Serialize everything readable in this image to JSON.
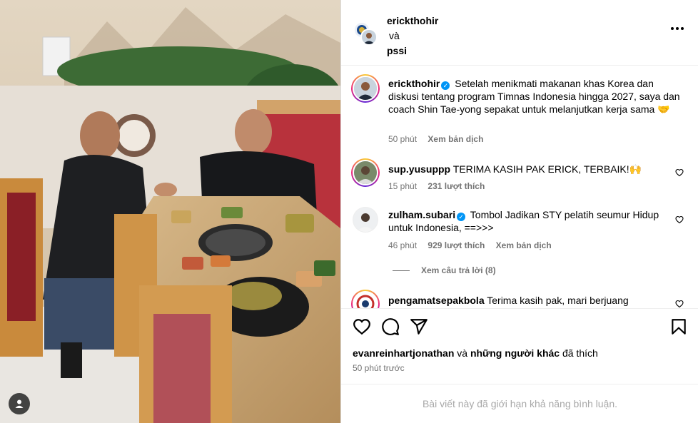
{
  "header": {
    "user1": "erickthohir",
    "and": "và",
    "user2": "pssi"
  },
  "caption": {
    "user": "erickthohir",
    "text": "Setelah menikmati makanan khas Korea dan diskusi tentang program Timnas Indonesia hingga 2027, saya dan coach Shin Tae-yong sepakat untuk melanjutkan kerja sama",
    "emoji": "🤝",
    "time": "50 phút",
    "translate": "Xem bản dịch"
  },
  "comments": [
    {
      "user": "sup.yusuppp",
      "text": "TERIMA KASIH PAK ERICK, TERBAIK!",
      "emoji": "🙌",
      "time": "15 phút",
      "likes": "231 lượt thích",
      "translate": ""
    },
    {
      "user": "zulham.subari",
      "text": "Tombol Jadikan STY pelatih seumur Hidup untuk Indonesia, ==>>>",
      "emoji": "",
      "time": "46 phút",
      "likes": "929 lượt thích",
      "translate": "Xem bản dịch"
    },
    {
      "user": "pengamatsepakbola",
      "text": "Terima kasih pak, mari berjuang bersama",
      "emoji": "",
      "time": "",
      "likes": "",
      "translate": ""
    }
  ],
  "view_replies": "Xem câu trả lời (8)",
  "likes": {
    "user": "evanreinhartjonathan",
    "and": "và",
    "others": "những người khác",
    "suffix": "đã thích"
  },
  "post_time": "50 phút trước",
  "comments_limited": "Bài viết này đã giới hạn khả năng bình luận.",
  "icons": {
    "like": "heart-icon",
    "comment": "comment-icon",
    "share": "share-icon",
    "save": "bookmark-icon",
    "more": "more-icon",
    "tagged": "user-tag-icon"
  },
  "colors": {
    "verified": "#0095f6",
    "muted": "#737373",
    "border": "#dbdbdb"
  }
}
